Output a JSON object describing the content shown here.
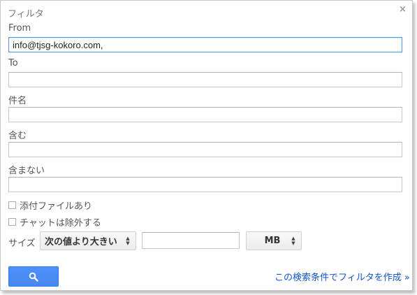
{
  "dialog": {
    "title": "フィルタ",
    "close_icon": "×"
  },
  "fields": {
    "from": {
      "label": "From",
      "value": "info@tjsg-kokoro.com,"
    },
    "to": {
      "label": "To",
      "value": ""
    },
    "subject": {
      "label": "件名",
      "value": ""
    },
    "has_words": {
      "label": "含む",
      "value": ""
    },
    "doesnt_have": {
      "label": "含まない",
      "value": ""
    }
  },
  "checkboxes": {
    "has_attachment": {
      "label": "添付ファイルあり",
      "checked": false
    },
    "exclude_chats": {
      "label": "チャットは除外する",
      "checked": false
    }
  },
  "size": {
    "label": "サイズ",
    "comparator": "次の値より大きい",
    "value": "",
    "unit": "MB"
  },
  "actions": {
    "search_icon": "search-icon",
    "create_filter_link": "この検索条件でフィルタを作成 »"
  },
  "colors": {
    "accent_blue": "#4d90fe",
    "link": "#1155cc"
  }
}
